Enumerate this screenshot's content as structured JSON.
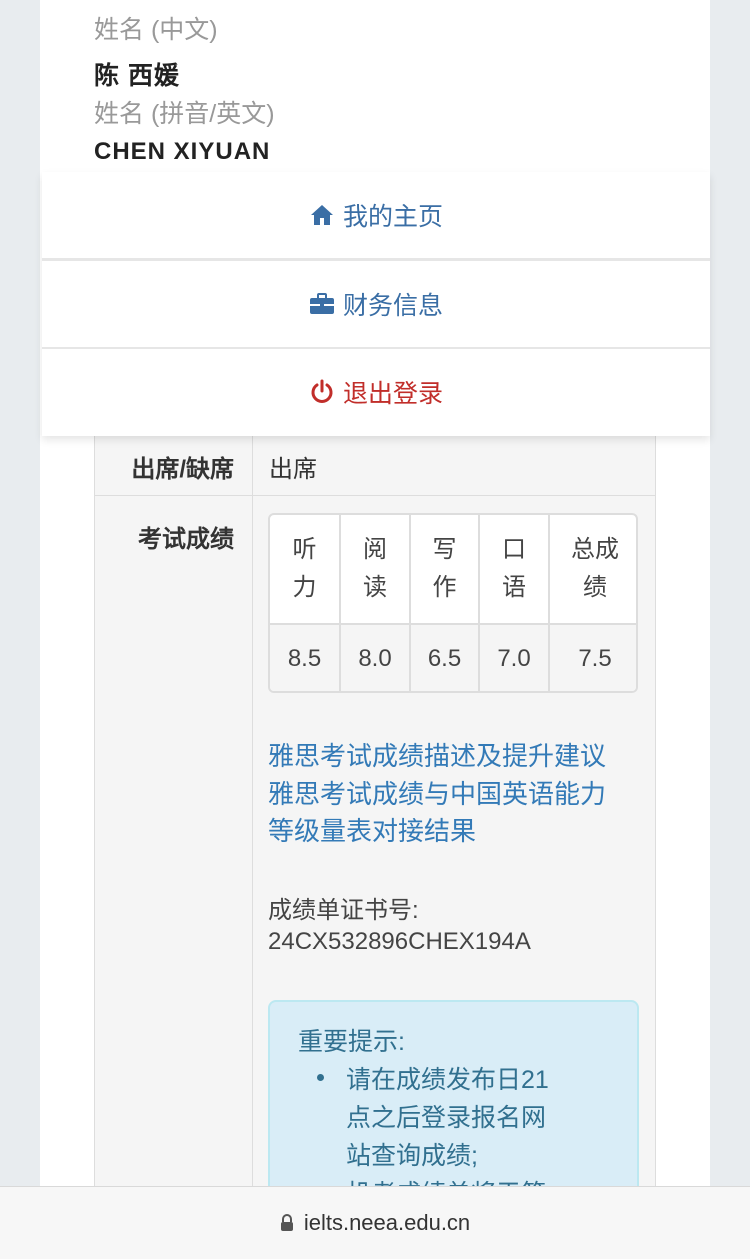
{
  "profile": {
    "name_cn_label": "姓名 (中文)",
    "name_cn": "陈  西媛",
    "name_en_label": "姓名 (拼音/英文)",
    "name_en": "CHEN  XIYUAN"
  },
  "menu": {
    "items": [
      {
        "label": "我的主页",
        "icon": "home-icon"
      },
      {
        "label": "财务信息",
        "icon": "briefcase-icon"
      },
      {
        "label": "退出登录",
        "icon": "power-icon"
      }
    ]
  },
  "results": {
    "attendance_label": "出席/缺席",
    "attendance_value": "出席",
    "score_label": "考试成绩",
    "score_headers": [
      [
        "听",
        "力"
      ],
      [
        "阅",
        "读"
      ],
      [
        "写",
        "作"
      ],
      [
        "口",
        "语"
      ],
      [
        "总成",
        "绩"
      ]
    ],
    "score_values": [
      "8.5",
      "8.0",
      "6.5",
      "7.0",
      "7.5"
    ],
    "link_description": "雅思考试成绩描述及提升建议",
    "link_cse_line1": "雅思考试成绩与中国英语能力",
    "link_cse_line2": "等级量表对接结果",
    "trf_label": "成绩单证书号:",
    "trf_number": "24CX532896CHEX194A"
  },
  "notice": {
    "title": "重要提示:",
    "lines": [
      "请在成绩发布日21",
      "点之后登录报名网",
      "站查询成绩;",
      "机考成绩单将于第"
    ]
  },
  "browser": {
    "url": "ielts.neea.edu.cn"
  },
  "colors": {
    "link": "#337ab7",
    "menu_text": "#3a6ea5",
    "logout": "#c12e2a",
    "notice_bg": "#d9edf7",
    "notice_text": "#31708f"
  }
}
